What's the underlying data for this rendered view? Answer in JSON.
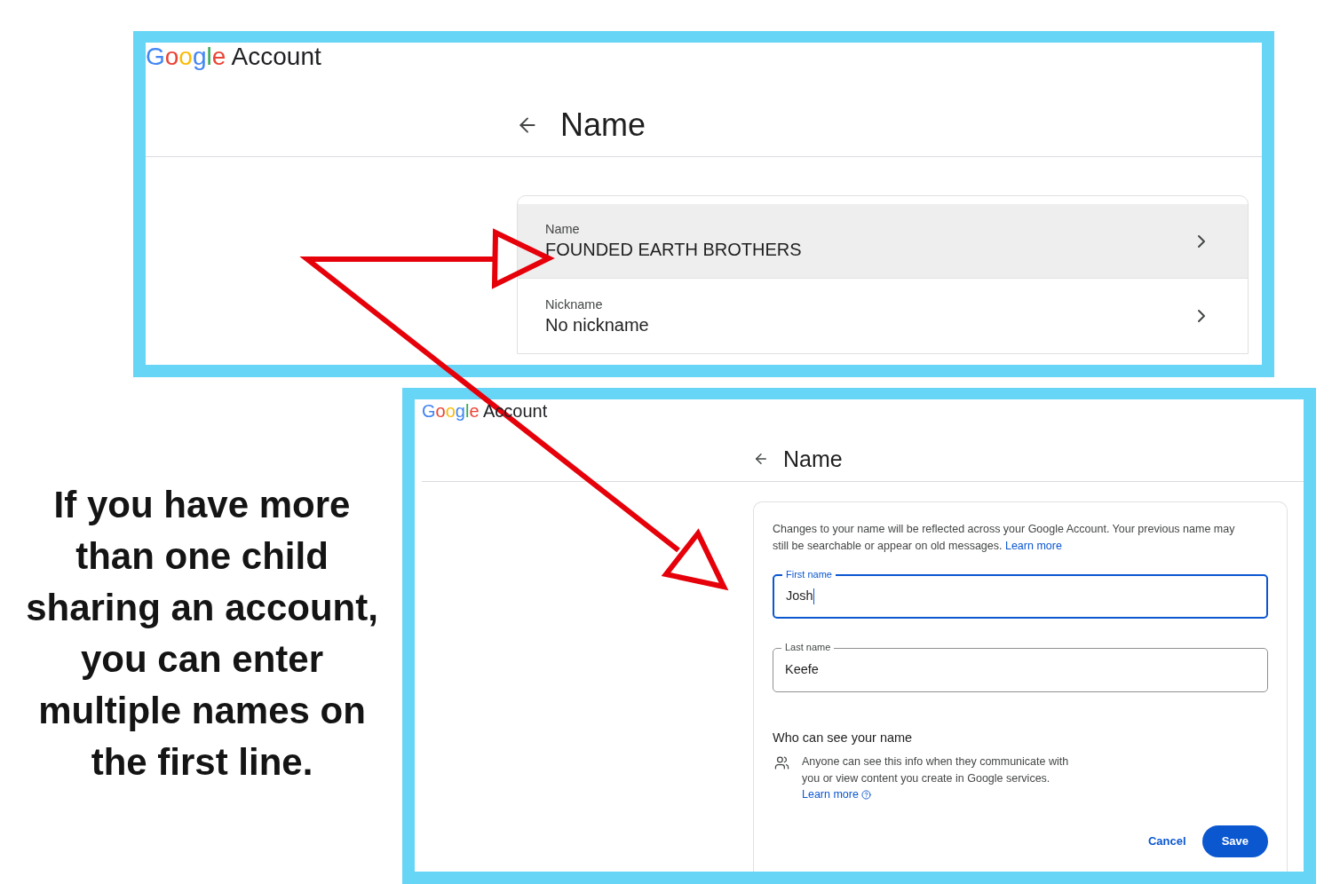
{
  "caption": "If you have more\nthan one child\nsharing an account,\nyou can enter\nmultiple names on\nthe first line.",
  "screenshots": [
    {
      "kind": "name_overview",
      "logo": {
        "brand": "Google",
        "product": "Account"
      },
      "page_title": "Name",
      "rows": [
        {
          "label": "Name",
          "value": "FOUNDED EARTH BROTHERS",
          "highlighted": true
        },
        {
          "label": "Nickname",
          "value": "No nickname",
          "highlighted": false
        }
      ]
    },
    {
      "kind": "name_edit",
      "logo": {
        "brand": "Google",
        "product": "Account"
      },
      "page_title": "Name",
      "notice": {
        "text": "Changes to your name will be reflected across your Google Account. Your previous name may still be searchable or appear on old messages.",
        "link": "Learn more"
      },
      "fields": [
        {
          "label": "First name",
          "value": "Josh",
          "focused": true
        },
        {
          "label": "Last name",
          "value": "Keefe",
          "focused": false
        }
      ],
      "visibility": {
        "heading": "Who can see your name",
        "text": "Anyone can see this info when they communicate with you or view content you create in Google services.",
        "link": "Learn more"
      },
      "buttons": [
        {
          "label": "Cancel",
          "kind": "text"
        },
        {
          "label": "Save",
          "kind": "filled"
        }
      ]
    }
  ]
}
